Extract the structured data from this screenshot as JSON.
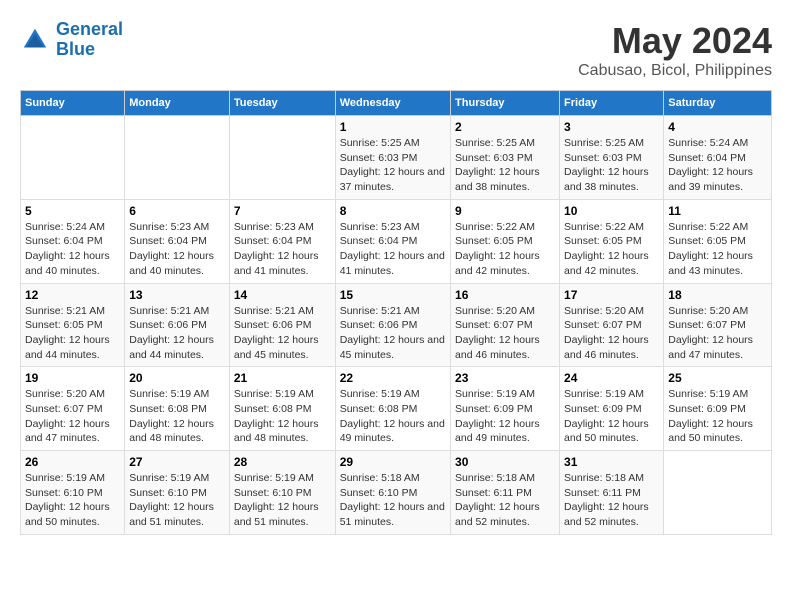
{
  "header": {
    "logo_line1": "General",
    "logo_line2": "Blue",
    "title": "May 2024",
    "subtitle": "Cabusao, Bicol, Philippines"
  },
  "weekdays": [
    "Sunday",
    "Monday",
    "Tuesday",
    "Wednesday",
    "Thursday",
    "Friday",
    "Saturday"
  ],
  "weeks": [
    [
      {
        "day": "",
        "sunrise": "",
        "sunset": "",
        "daylight": "",
        "empty": true
      },
      {
        "day": "",
        "sunrise": "",
        "sunset": "",
        "daylight": "",
        "empty": true
      },
      {
        "day": "",
        "sunrise": "",
        "sunset": "",
        "daylight": "",
        "empty": true
      },
      {
        "day": "1",
        "sunrise": "Sunrise: 5:25 AM",
        "sunset": "Sunset: 6:03 PM",
        "daylight": "Daylight: 12 hours and 37 minutes."
      },
      {
        "day": "2",
        "sunrise": "Sunrise: 5:25 AM",
        "sunset": "Sunset: 6:03 PM",
        "daylight": "Daylight: 12 hours and 38 minutes."
      },
      {
        "day": "3",
        "sunrise": "Sunrise: 5:25 AM",
        "sunset": "Sunset: 6:03 PM",
        "daylight": "Daylight: 12 hours and 38 minutes."
      },
      {
        "day": "4",
        "sunrise": "Sunrise: 5:24 AM",
        "sunset": "Sunset: 6:04 PM",
        "daylight": "Daylight: 12 hours and 39 minutes."
      }
    ],
    [
      {
        "day": "5",
        "sunrise": "Sunrise: 5:24 AM",
        "sunset": "Sunset: 6:04 PM",
        "daylight": "Daylight: 12 hours and 40 minutes."
      },
      {
        "day": "6",
        "sunrise": "Sunrise: 5:23 AM",
        "sunset": "Sunset: 6:04 PM",
        "daylight": "Daylight: 12 hours and 40 minutes."
      },
      {
        "day": "7",
        "sunrise": "Sunrise: 5:23 AM",
        "sunset": "Sunset: 6:04 PM",
        "daylight": "Daylight: 12 hours and 41 minutes."
      },
      {
        "day": "8",
        "sunrise": "Sunrise: 5:23 AM",
        "sunset": "Sunset: 6:04 PM",
        "daylight": "Daylight: 12 hours and 41 minutes."
      },
      {
        "day": "9",
        "sunrise": "Sunrise: 5:22 AM",
        "sunset": "Sunset: 6:05 PM",
        "daylight": "Daylight: 12 hours and 42 minutes."
      },
      {
        "day": "10",
        "sunrise": "Sunrise: 5:22 AM",
        "sunset": "Sunset: 6:05 PM",
        "daylight": "Daylight: 12 hours and 42 minutes."
      },
      {
        "day": "11",
        "sunrise": "Sunrise: 5:22 AM",
        "sunset": "Sunset: 6:05 PM",
        "daylight": "Daylight: 12 hours and 43 minutes."
      }
    ],
    [
      {
        "day": "12",
        "sunrise": "Sunrise: 5:21 AM",
        "sunset": "Sunset: 6:05 PM",
        "daylight": "Daylight: 12 hours and 44 minutes."
      },
      {
        "day": "13",
        "sunrise": "Sunrise: 5:21 AM",
        "sunset": "Sunset: 6:06 PM",
        "daylight": "Daylight: 12 hours and 44 minutes."
      },
      {
        "day": "14",
        "sunrise": "Sunrise: 5:21 AM",
        "sunset": "Sunset: 6:06 PM",
        "daylight": "Daylight: 12 hours and 45 minutes."
      },
      {
        "day": "15",
        "sunrise": "Sunrise: 5:21 AM",
        "sunset": "Sunset: 6:06 PM",
        "daylight": "Daylight: 12 hours and 45 minutes."
      },
      {
        "day": "16",
        "sunrise": "Sunrise: 5:20 AM",
        "sunset": "Sunset: 6:07 PM",
        "daylight": "Daylight: 12 hours and 46 minutes."
      },
      {
        "day": "17",
        "sunrise": "Sunrise: 5:20 AM",
        "sunset": "Sunset: 6:07 PM",
        "daylight": "Daylight: 12 hours and 46 minutes."
      },
      {
        "day": "18",
        "sunrise": "Sunrise: 5:20 AM",
        "sunset": "Sunset: 6:07 PM",
        "daylight": "Daylight: 12 hours and 47 minutes."
      }
    ],
    [
      {
        "day": "19",
        "sunrise": "Sunrise: 5:20 AM",
        "sunset": "Sunset: 6:07 PM",
        "daylight": "Daylight: 12 hours and 47 minutes."
      },
      {
        "day": "20",
        "sunrise": "Sunrise: 5:19 AM",
        "sunset": "Sunset: 6:08 PM",
        "daylight": "Daylight: 12 hours and 48 minutes."
      },
      {
        "day": "21",
        "sunrise": "Sunrise: 5:19 AM",
        "sunset": "Sunset: 6:08 PM",
        "daylight": "Daylight: 12 hours and 48 minutes."
      },
      {
        "day": "22",
        "sunrise": "Sunrise: 5:19 AM",
        "sunset": "Sunset: 6:08 PM",
        "daylight": "Daylight: 12 hours and 49 minutes."
      },
      {
        "day": "23",
        "sunrise": "Sunrise: 5:19 AM",
        "sunset": "Sunset: 6:09 PM",
        "daylight": "Daylight: 12 hours and 49 minutes."
      },
      {
        "day": "24",
        "sunrise": "Sunrise: 5:19 AM",
        "sunset": "Sunset: 6:09 PM",
        "daylight": "Daylight: 12 hours and 50 minutes."
      },
      {
        "day": "25",
        "sunrise": "Sunrise: 5:19 AM",
        "sunset": "Sunset: 6:09 PM",
        "daylight": "Daylight: 12 hours and 50 minutes."
      }
    ],
    [
      {
        "day": "26",
        "sunrise": "Sunrise: 5:19 AM",
        "sunset": "Sunset: 6:10 PM",
        "daylight": "Daylight: 12 hours and 50 minutes."
      },
      {
        "day": "27",
        "sunrise": "Sunrise: 5:19 AM",
        "sunset": "Sunset: 6:10 PM",
        "daylight": "Daylight: 12 hours and 51 minutes."
      },
      {
        "day": "28",
        "sunrise": "Sunrise: 5:19 AM",
        "sunset": "Sunset: 6:10 PM",
        "daylight": "Daylight: 12 hours and 51 minutes."
      },
      {
        "day": "29",
        "sunrise": "Sunrise: 5:18 AM",
        "sunset": "Sunset: 6:10 PM",
        "daylight": "Daylight: 12 hours and 51 minutes."
      },
      {
        "day": "30",
        "sunrise": "Sunrise: 5:18 AM",
        "sunset": "Sunset: 6:11 PM",
        "daylight": "Daylight: 12 hours and 52 minutes."
      },
      {
        "day": "31",
        "sunrise": "Sunrise: 5:18 AM",
        "sunset": "Sunset: 6:11 PM",
        "daylight": "Daylight: 12 hours and 52 minutes."
      },
      {
        "day": "",
        "sunrise": "",
        "sunset": "",
        "daylight": "",
        "empty": true
      }
    ]
  ]
}
